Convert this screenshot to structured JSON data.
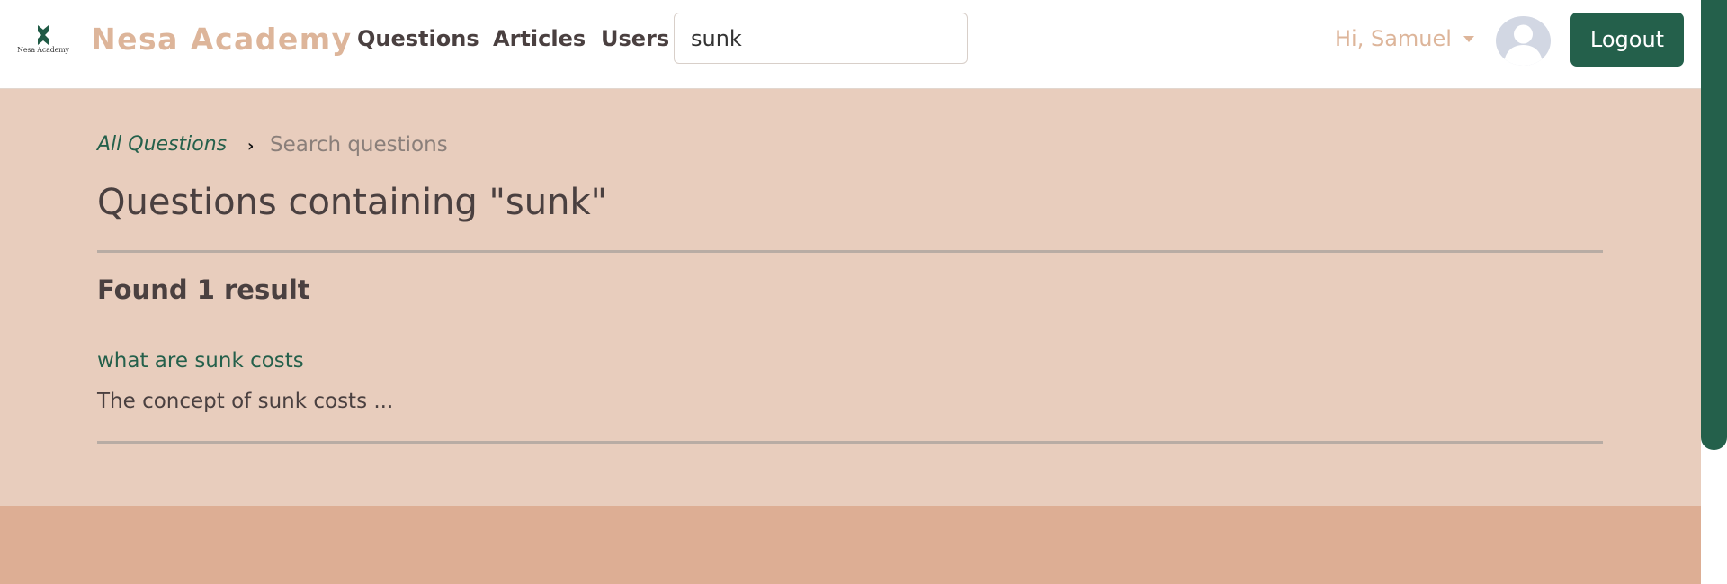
{
  "colors": {
    "brand_accent": "#ddb59a",
    "primary_green": "#24604b",
    "page_background": "#e8cdbd",
    "footer_background": "#ddae94",
    "text": "#4a4040"
  },
  "navbar": {
    "logo_text": "Nesa Academy",
    "logo_icon": "academy-logo-icon",
    "brand": "Nesa Academy",
    "links": [
      "Questions",
      "Articles",
      "Users"
    ],
    "search_value": "sunk",
    "user_greeting": "Hi, Samuel",
    "avatar_icon": "user-avatar-icon",
    "logout_label": "Logout"
  },
  "breadcrumb": {
    "root": "All Questions",
    "separator_icon": "chevron-right-icon",
    "current": "Search questions"
  },
  "main": {
    "title": "Questions containing \"sunk\"",
    "result_count": "Found 1 result",
    "results": [
      {
        "title": "what are sunk costs",
        "excerpt": "The concept of sunk costs ..."
      }
    ]
  }
}
